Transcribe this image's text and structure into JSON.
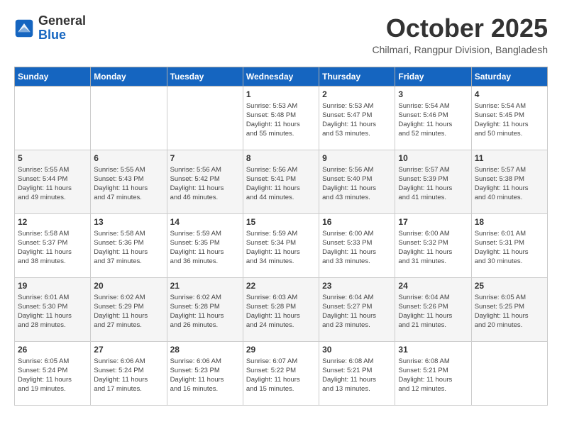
{
  "logo": {
    "general": "General",
    "blue": "Blue"
  },
  "header": {
    "month": "October 2025",
    "location": "Chilmari, Rangpur Division, Bangladesh"
  },
  "days_of_week": [
    "Sunday",
    "Monday",
    "Tuesday",
    "Wednesday",
    "Thursday",
    "Friday",
    "Saturday"
  ],
  "weeks": [
    [
      {
        "day": "",
        "info": ""
      },
      {
        "day": "",
        "info": ""
      },
      {
        "day": "",
        "info": ""
      },
      {
        "day": "1",
        "info": "Sunrise: 5:53 AM\nSunset: 5:48 PM\nDaylight: 11 hours\nand 55 minutes."
      },
      {
        "day": "2",
        "info": "Sunrise: 5:53 AM\nSunset: 5:47 PM\nDaylight: 11 hours\nand 53 minutes."
      },
      {
        "day": "3",
        "info": "Sunrise: 5:54 AM\nSunset: 5:46 PM\nDaylight: 11 hours\nand 52 minutes."
      },
      {
        "day": "4",
        "info": "Sunrise: 5:54 AM\nSunset: 5:45 PM\nDaylight: 11 hours\nand 50 minutes."
      }
    ],
    [
      {
        "day": "5",
        "info": "Sunrise: 5:55 AM\nSunset: 5:44 PM\nDaylight: 11 hours\nand 49 minutes."
      },
      {
        "day": "6",
        "info": "Sunrise: 5:55 AM\nSunset: 5:43 PM\nDaylight: 11 hours\nand 47 minutes."
      },
      {
        "day": "7",
        "info": "Sunrise: 5:56 AM\nSunset: 5:42 PM\nDaylight: 11 hours\nand 46 minutes."
      },
      {
        "day": "8",
        "info": "Sunrise: 5:56 AM\nSunset: 5:41 PM\nDaylight: 11 hours\nand 44 minutes."
      },
      {
        "day": "9",
        "info": "Sunrise: 5:56 AM\nSunset: 5:40 PM\nDaylight: 11 hours\nand 43 minutes."
      },
      {
        "day": "10",
        "info": "Sunrise: 5:57 AM\nSunset: 5:39 PM\nDaylight: 11 hours\nand 41 minutes."
      },
      {
        "day": "11",
        "info": "Sunrise: 5:57 AM\nSunset: 5:38 PM\nDaylight: 11 hours\nand 40 minutes."
      }
    ],
    [
      {
        "day": "12",
        "info": "Sunrise: 5:58 AM\nSunset: 5:37 PM\nDaylight: 11 hours\nand 38 minutes."
      },
      {
        "day": "13",
        "info": "Sunrise: 5:58 AM\nSunset: 5:36 PM\nDaylight: 11 hours\nand 37 minutes."
      },
      {
        "day": "14",
        "info": "Sunrise: 5:59 AM\nSunset: 5:35 PM\nDaylight: 11 hours\nand 36 minutes."
      },
      {
        "day": "15",
        "info": "Sunrise: 5:59 AM\nSunset: 5:34 PM\nDaylight: 11 hours\nand 34 minutes."
      },
      {
        "day": "16",
        "info": "Sunrise: 6:00 AM\nSunset: 5:33 PM\nDaylight: 11 hours\nand 33 minutes."
      },
      {
        "day": "17",
        "info": "Sunrise: 6:00 AM\nSunset: 5:32 PM\nDaylight: 11 hours\nand 31 minutes."
      },
      {
        "day": "18",
        "info": "Sunrise: 6:01 AM\nSunset: 5:31 PM\nDaylight: 11 hours\nand 30 minutes."
      }
    ],
    [
      {
        "day": "19",
        "info": "Sunrise: 6:01 AM\nSunset: 5:30 PM\nDaylight: 11 hours\nand 28 minutes."
      },
      {
        "day": "20",
        "info": "Sunrise: 6:02 AM\nSunset: 5:29 PM\nDaylight: 11 hours\nand 27 minutes."
      },
      {
        "day": "21",
        "info": "Sunrise: 6:02 AM\nSunset: 5:28 PM\nDaylight: 11 hours\nand 26 minutes."
      },
      {
        "day": "22",
        "info": "Sunrise: 6:03 AM\nSunset: 5:28 PM\nDaylight: 11 hours\nand 24 minutes."
      },
      {
        "day": "23",
        "info": "Sunrise: 6:04 AM\nSunset: 5:27 PM\nDaylight: 11 hours\nand 23 minutes."
      },
      {
        "day": "24",
        "info": "Sunrise: 6:04 AM\nSunset: 5:26 PM\nDaylight: 11 hours\nand 21 minutes."
      },
      {
        "day": "25",
        "info": "Sunrise: 6:05 AM\nSunset: 5:25 PM\nDaylight: 11 hours\nand 20 minutes."
      }
    ],
    [
      {
        "day": "26",
        "info": "Sunrise: 6:05 AM\nSunset: 5:24 PM\nDaylight: 11 hours\nand 19 minutes."
      },
      {
        "day": "27",
        "info": "Sunrise: 6:06 AM\nSunset: 5:24 PM\nDaylight: 11 hours\nand 17 minutes."
      },
      {
        "day": "28",
        "info": "Sunrise: 6:06 AM\nSunset: 5:23 PM\nDaylight: 11 hours\nand 16 minutes."
      },
      {
        "day": "29",
        "info": "Sunrise: 6:07 AM\nSunset: 5:22 PM\nDaylight: 11 hours\nand 15 minutes."
      },
      {
        "day": "30",
        "info": "Sunrise: 6:08 AM\nSunset: 5:21 PM\nDaylight: 11 hours\nand 13 minutes."
      },
      {
        "day": "31",
        "info": "Sunrise: 6:08 AM\nSunset: 5:21 PM\nDaylight: 11 hours\nand 12 minutes."
      },
      {
        "day": "",
        "info": ""
      }
    ]
  ]
}
